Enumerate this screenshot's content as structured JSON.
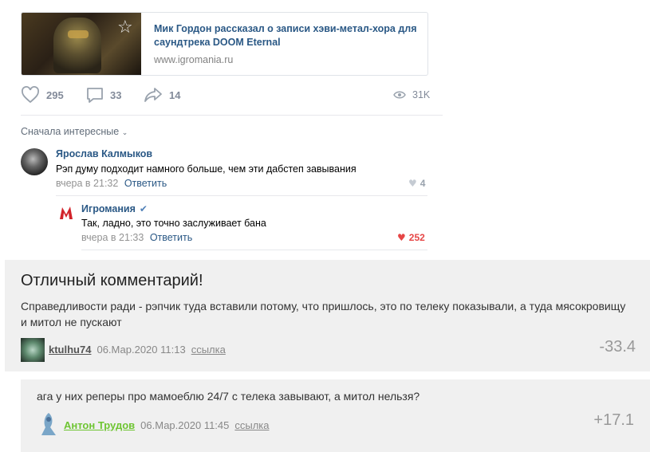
{
  "post": {
    "link_card": {
      "title": "Мик Гордон рассказал о записи хэви-метал-хора для саундтрека DOOM Eternal",
      "domain": "www.igromania.ru",
      "bookmark_icon": "star-icon"
    },
    "actions": {
      "likes": "295",
      "comments": "33",
      "shares": "14",
      "views": "31K"
    }
  },
  "comments": {
    "sort_label": "Сначала интересные",
    "items": [
      {
        "author": "Ярослав Калмыков",
        "text": "Рэп думу подходит намного больше, чем эти дабстеп завывания",
        "time": "вчера в 21:32",
        "reply_label": "Ответить",
        "likes": "4",
        "liked": false
      },
      {
        "author": "Игромания",
        "verified": true,
        "text": "Так, ладно, это точно заслуживает бана",
        "time": "вчера в 21:33",
        "reply_label": "Ответить",
        "likes": "252",
        "liked": true
      }
    ]
  },
  "featured": {
    "title": "Отличный комментарий!",
    "text": "Справедливости ради - рэпчик туда вставили потому, что пришлось, это по телеку показывали, а туда мясокровищу и митол не пускают",
    "author": "ktulhu74",
    "date": "06.Мар.2020 11:13",
    "link_label": "ссылка",
    "score": "-33.4"
  },
  "reply": {
    "text": "ага у них реперы про мамоеблю 24/7 с телека завывают, а митол нельзя?",
    "author": "Антон Трудов",
    "date": "06.Мар.2020 11:45",
    "link_label": "ссылка",
    "score": "+17.1"
  },
  "colors": {
    "vk_link": "#2a5885",
    "muted": "#828a99",
    "like_red": "#e64646",
    "verified": "#5181b8",
    "green_author": "#6ec532",
    "box_bg": "#f0f0f0"
  }
}
